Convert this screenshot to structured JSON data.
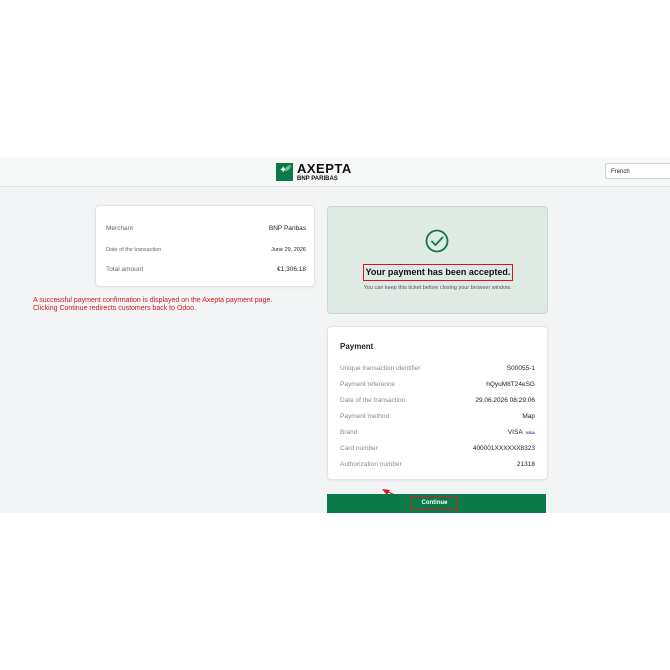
{
  "header": {
    "logo_title": "AXEPTA",
    "logo_subtitle": "BNP PARIBAS",
    "language": "French"
  },
  "merchant": {
    "rows": [
      {
        "label": "Merchant",
        "value": "BNP Paribas"
      },
      {
        "label": "Date of the transaction",
        "value": "June 29, 2026"
      },
      {
        "label": "Total amount",
        "value": "€1,306.18"
      }
    ]
  },
  "status": {
    "title": "Your payment has been accepted.",
    "subtitle": "You can keep this ticket before closing your browser window."
  },
  "annotation": {
    "line1": "A successful payment confirmation is displayed on the Axepta payment page.",
    "line2": "Clicking Continue redirects customers back to Odoo."
  },
  "payment": {
    "title": "Payment",
    "rows": [
      {
        "label": "Unique transaction identifier",
        "value": "S00055-1"
      },
      {
        "label": "Payment reference",
        "value": "hQyuM8T24eSG"
      },
      {
        "label": "Date of the transaction",
        "value": "29.06.2026 08:29:06"
      },
      {
        "label": "Payment method",
        "value": "Map"
      },
      {
        "label": "Brand",
        "value": "VISA",
        "badge": "VISA"
      },
      {
        "label": "Card number",
        "value": "400001XXXXXX8323"
      },
      {
        "label": "Authorization number",
        "value": "21318"
      }
    ]
  },
  "continue_label": "Continue",
  "colors": {
    "brand_green": "#0b7a4a",
    "success_bg": "#dfeae4",
    "annotation_red": "#d11a1a"
  },
  "icons": [
    "axepta-logo-icon",
    "check-circle-icon",
    "visa-icon",
    "annotation-arrow"
  ]
}
